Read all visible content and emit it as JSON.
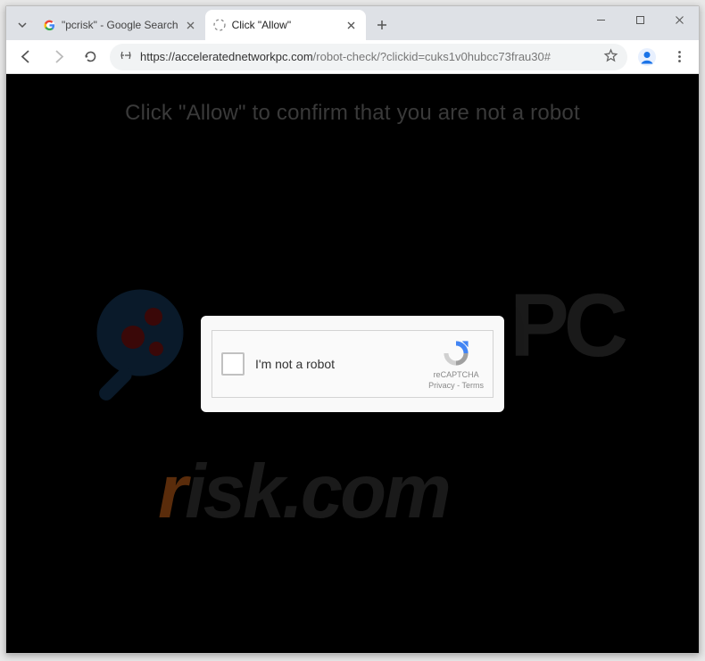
{
  "tabs": [
    {
      "title": "\"pcrisk\" - Google Search",
      "active": false
    },
    {
      "title": "Click \"Allow\"",
      "active": true
    }
  ],
  "url": {
    "scheme": "https://",
    "host": "acceleratednetworkpc.com",
    "path": "/robot-check/?clickid=cuks1v0hubcc73frau30#"
  },
  "page": {
    "heading": "Click \"Allow\" to confirm that you are not a robot"
  },
  "captcha": {
    "label": "I'm not a robot",
    "brand": "reCAPTCHA",
    "links": "Privacy - Terms"
  },
  "watermark": {
    "pc": "PC",
    "risk_first": "r",
    "risk_rest": "isk.com"
  }
}
